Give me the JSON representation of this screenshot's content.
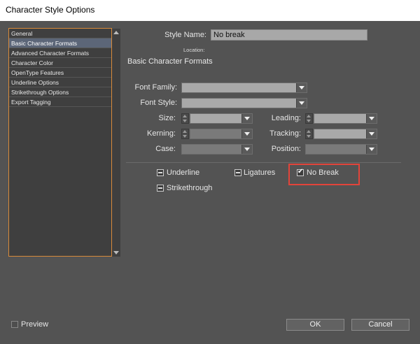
{
  "window": {
    "title": "Character Style Options"
  },
  "sidebar": {
    "items": [
      {
        "label": "General",
        "selected": false
      },
      {
        "label": "Basic Character Formats",
        "selected": true
      },
      {
        "label": "Advanced Character Formats",
        "selected": false
      },
      {
        "label": "Character Color",
        "selected": false
      },
      {
        "label": "OpenType Features",
        "selected": false
      },
      {
        "label": "Underline Options",
        "selected": false
      },
      {
        "label": "Strikethrough Options",
        "selected": false
      },
      {
        "label": "Export Tagging",
        "selected": false
      }
    ]
  },
  "header": {
    "style_name_label": "Style Name:",
    "style_name_value": "No break",
    "location_label": "Location:"
  },
  "section": {
    "title": "Basic Character Formats"
  },
  "fields": {
    "font_family_label": "Font Family:",
    "font_style_label": "Font Style:",
    "size_label": "Size:",
    "leading_label": "Leading:",
    "kerning_label": "Kerning:",
    "tracking_label": "Tracking:",
    "case_label": "Case:",
    "position_label": "Position:"
  },
  "options": {
    "underline": {
      "label": "Underline",
      "state": "mixed"
    },
    "ligatures": {
      "label": "Ligatures",
      "state": "mixed"
    },
    "no_break": {
      "label": "No Break",
      "state": "checked"
    },
    "strikethrough": {
      "label": "Strikethrough",
      "state": "mixed"
    }
  },
  "footer": {
    "preview_label": "Preview",
    "ok_label": "OK",
    "cancel_label": "Cancel"
  },
  "colors": {
    "panel_bg": "#535353",
    "highlight_border": "#e2443a",
    "list_border": "#d88a3a",
    "selected_item": "#5c6678"
  }
}
